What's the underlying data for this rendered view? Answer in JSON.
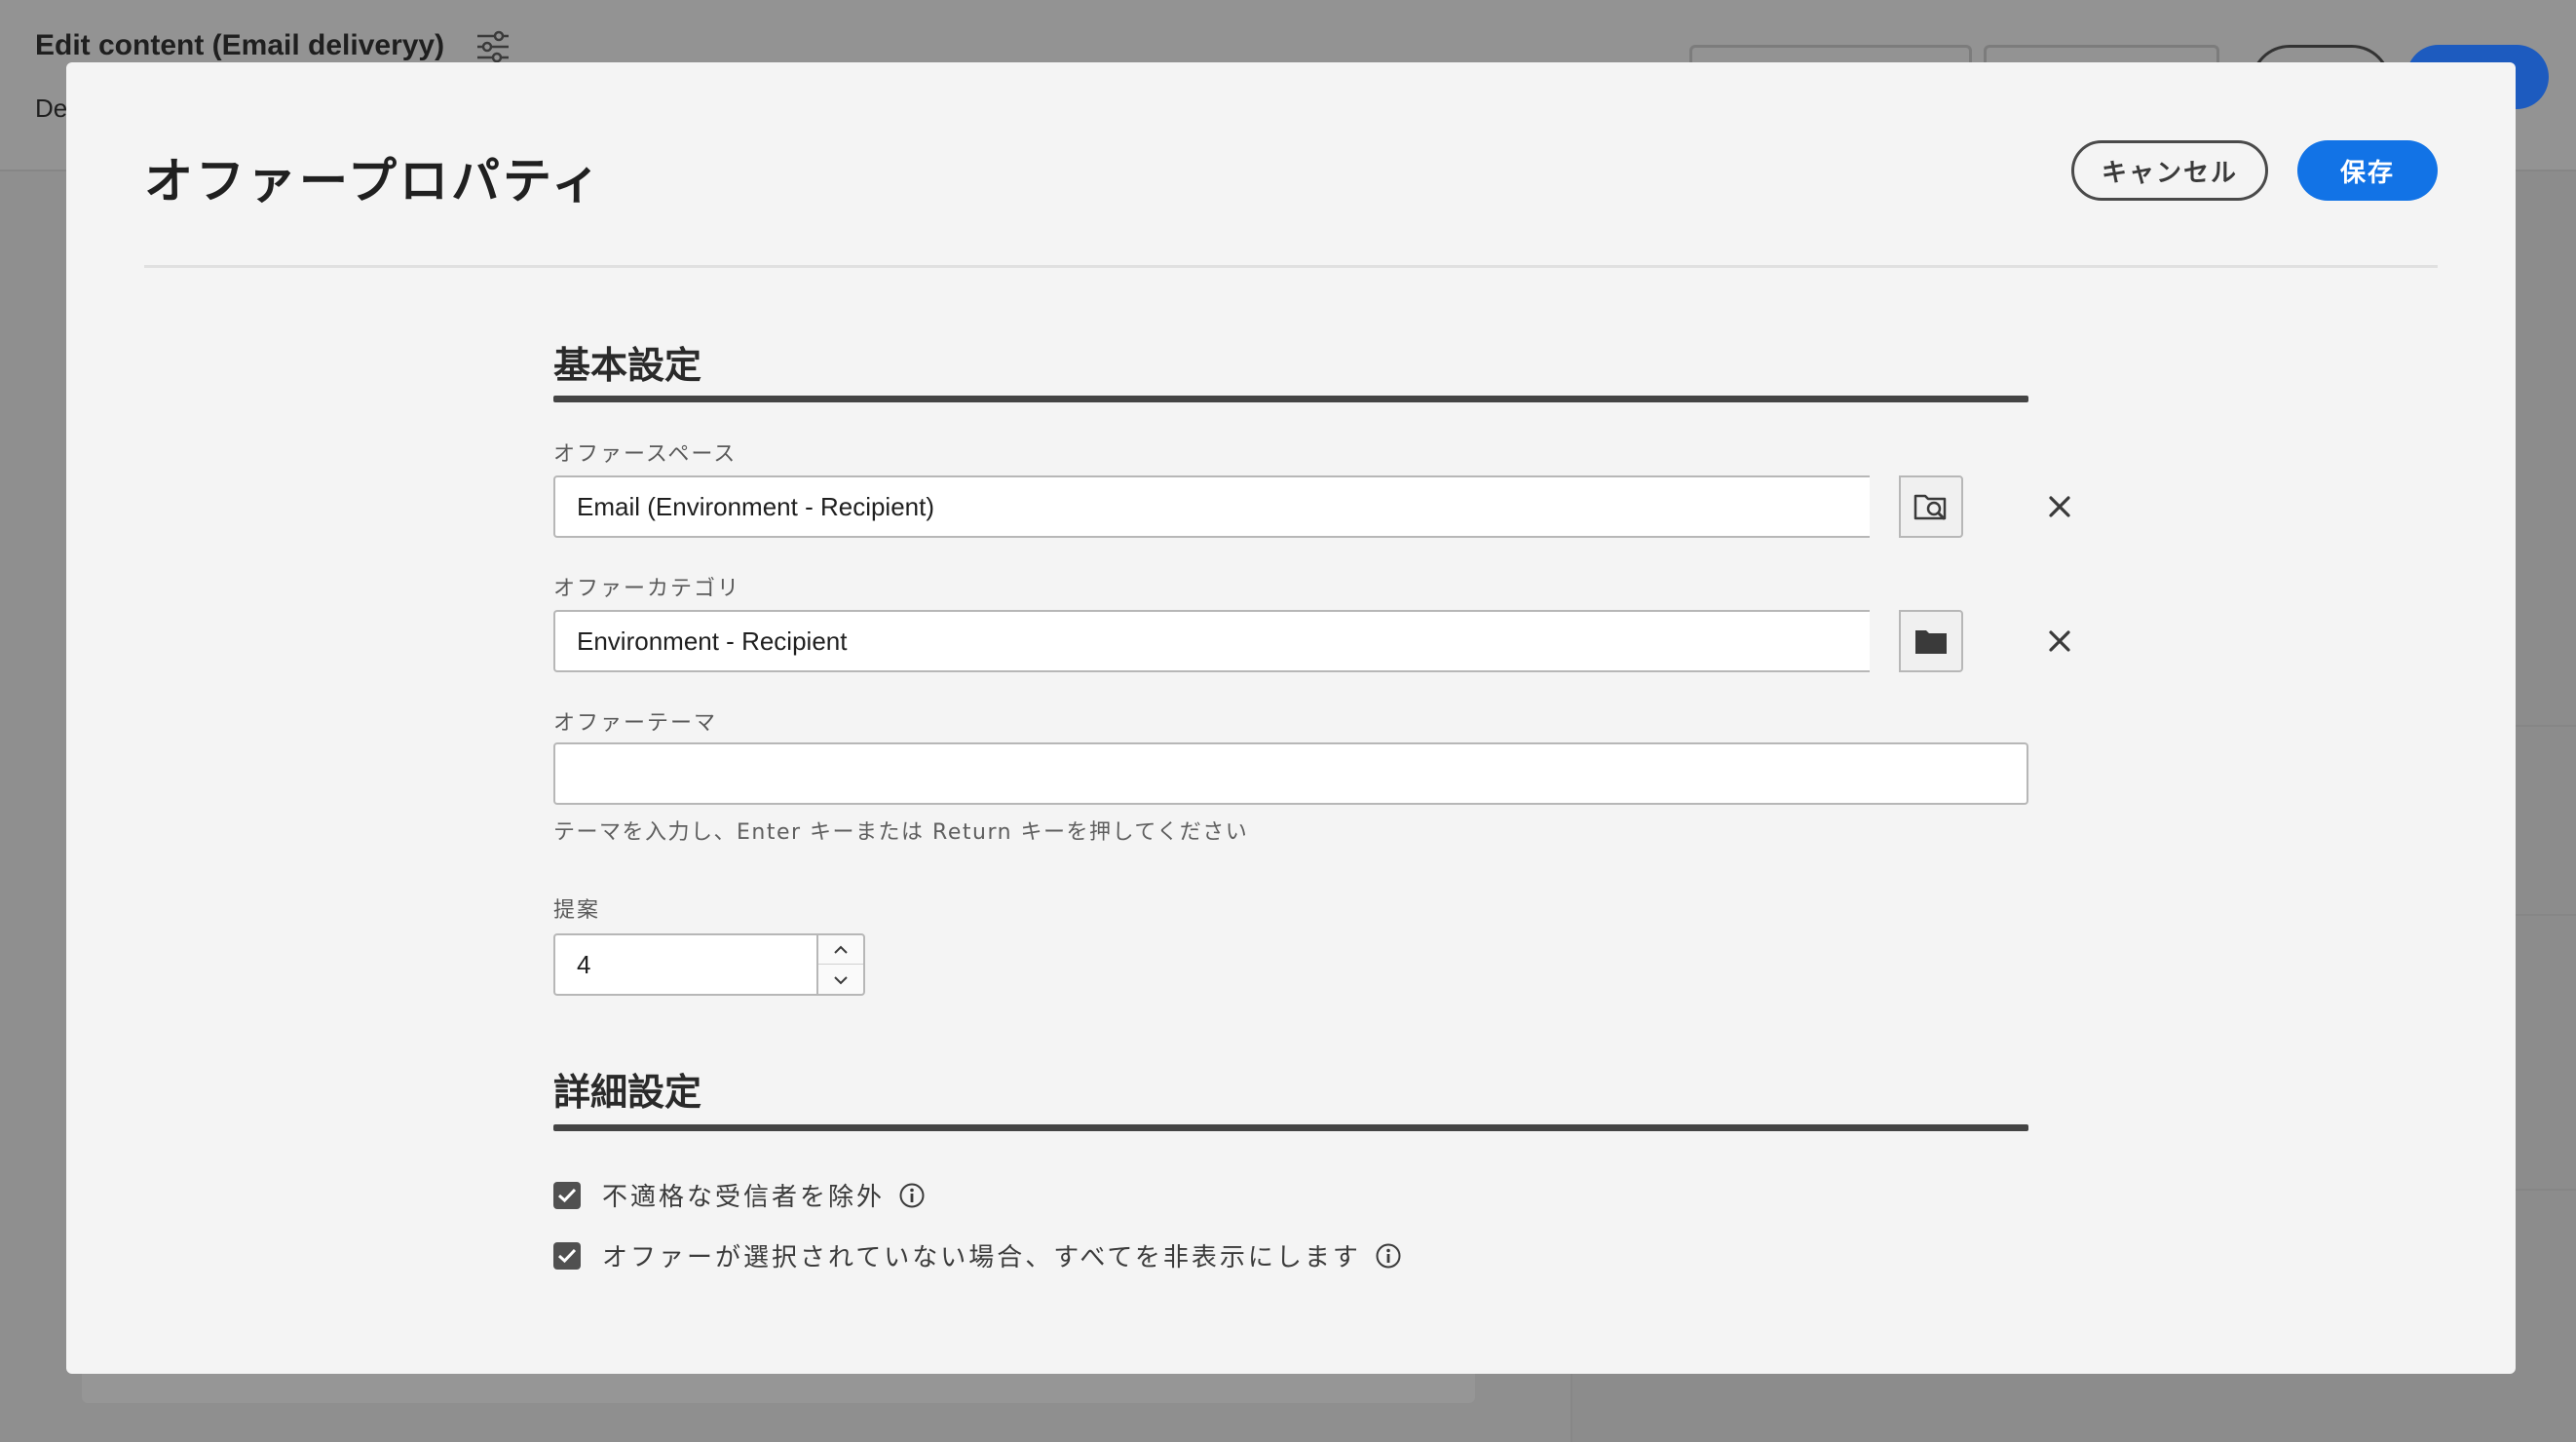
{
  "background": {
    "window_title": "Edit content (Email deliveryy)",
    "subtab_fragment": "De"
  },
  "modal": {
    "title": "オファープロパティ",
    "cancel_label": "キャンセル",
    "save_label": "保存"
  },
  "basic_settings": {
    "title": "基本設定",
    "offer_space": {
      "label": "オファースペース",
      "value": "Email (Environment - Recipient)"
    },
    "offer_category": {
      "label": "オファーカテゴリ",
      "value": "Environment - Recipient"
    },
    "offer_theme": {
      "label": "オファーテーマ",
      "value": "",
      "help_text": "テーマを入力し、Enter キーまたは Return キーを押してください"
    },
    "proposals": {
      "label": "提案",
      "value": "4"
    }
  },
  "advanced_settings": {
    "title": "詳細設定",
    "exclude_ineligible": {
      "label": "不適格な受信者を除外",
      "checked": true
    },
    "hide_all": {
      "label": "オファーが選択されていない場合、すべてを非表示にします",
      "checked": true
    }
  },
  "colors": {
    "primary": "#1273e6",
    "modal_bg": "#f4f4f4",
    "overlay": "#8f8f8f"
  }
}
